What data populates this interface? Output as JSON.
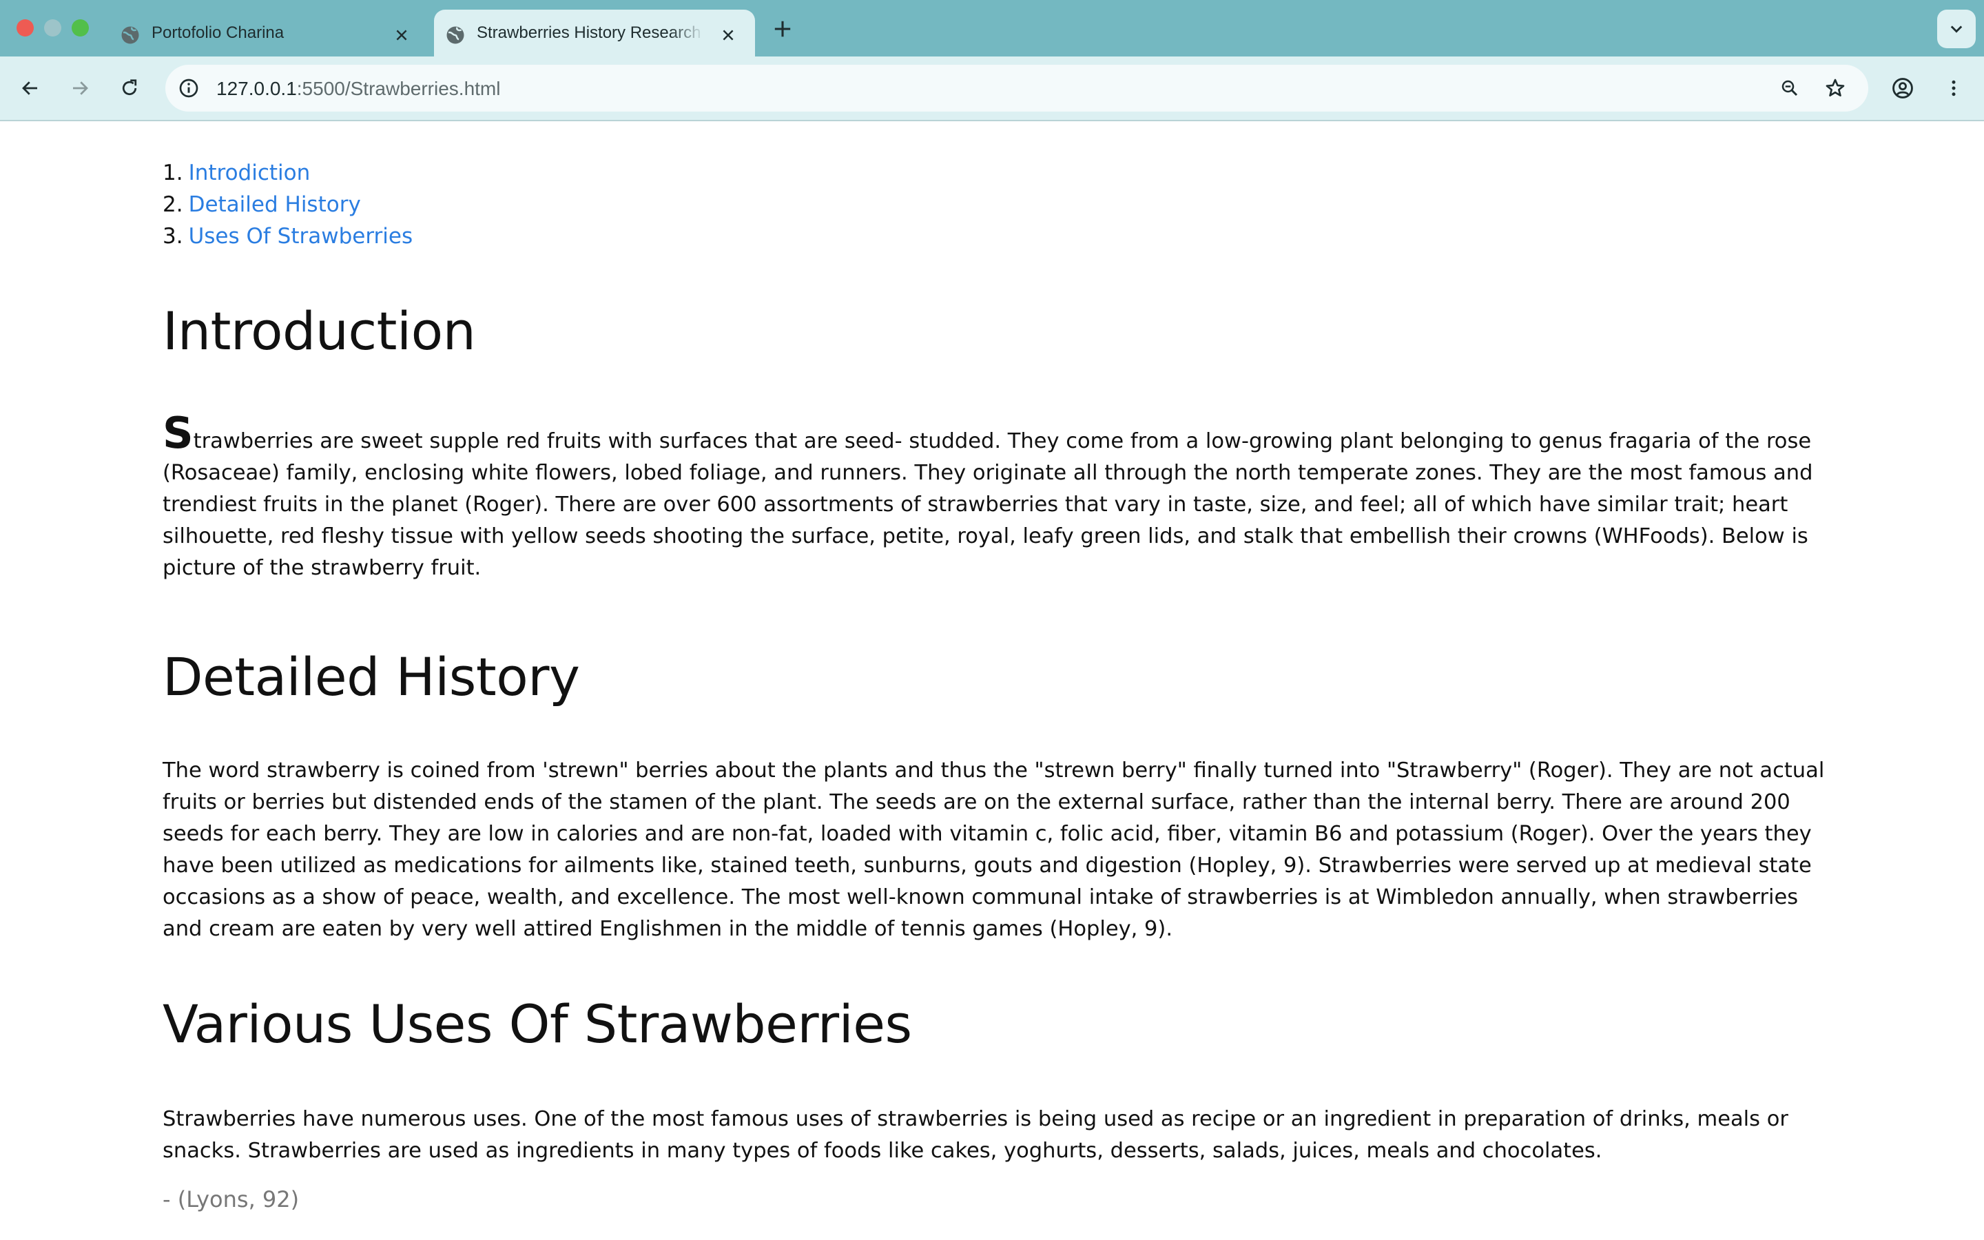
{
  "browser": {
    "tabs": [
      {
        "title": "Portofolio Charina",
        "active": false,
        "icon": "globe-icon"
      },
      {
        "title": "Strawberries History Research",
        "active": true,
        "icon": "globe-icon"
      }
    ],
    "url_host": "127.0.0.1",
    "url_path": ":5500/Strawberries.html",
    "icons": [
      "back-icon",
      "forward-icon",
      "reload-icon",
      "site-info-icon",
      "zoom-icon",
      "bookmark-star-icon",
      "profile-icon",
      "menu-icon"
    ]
  },
  "page": {
    "toc": [
      {
        "num": "1.",
        "label": "Introdiction"
      },
      {
        "num": "2.",
        "label": "Detailed History"
      },
      {
        "num": "3.",
        "label": "Uses Of Strawberries"
      }
    ],
    "intro": {
      "heading": "Introduction",
      "dropcap": "S",
      "text": "trawberries are sweet supple red fruits with surfaces that are seed- studded. They come from a low-growing plant belonging to genus fragaria of the rose (Rosaceae) family, enclosing white flowers, lobed foliage, and runners. They originate all through the north temperate zones. They are the most famous and trendiest fruits in the planet (Roger). There are over 600 assortments of strawberries that vary in taste, size, and feel; all of which have similar trait; heart silhouette, red fleshy tissue with yellow seeds shooting the surface, petite, royal, leafy green lids, and stalk that embellish their crowns (WHFoods). Below is picture of the strawberry fruit."
    },
    "history": {
      "heading": "Detailed History",
      "text": "The word strawberry is coined from 'strewn\" berries about the plants and thus the \"strewn berry\" finally turned into \"Strawberry\" (Roger). They are not actual fruits or berries but distended ends of the stamen of the plant. The seeds are on the external surface, rather than the internal berry. There are around 200 seeds for each berry. They are low in calories and are non-fat, loaded with vitamin c, folic acid, fiber, vitamin B6 and potassium (Roger). Over the years they have been utilized as medications for ailments like, stained teeth, sunburns, gouts and digestion (Hopley, 9). Strawberries were served up at medieval state occasions as a show of peace, wealth, and excellence. The most well-known communal intake of strawberries is at Wimbledon annually, when strawberries and cream are eaten by very well attired Englishmen in the middle of tennis games (Hopley, 9)."
    },
    "uses": {
      "heading": "Various Uses Of Strawberries",
      "text": "Strawberries have numerous uses. One of the most famous uses of strawberries is being used as recipe or an ingredient in preparation of drinks, meals or snacks. Strawberries are used as ingredients in many types of foods like cakes, yoghurts, desserts, salads, juices, meals and chocolates.",
      "citation": "- (Lyons, 92)"
    }
  },
  "colors": {
    "tabstrip": "#74b8c1",
    "toolbar": "#dcf0f2",
    "link": "#2a7de1"
  }
}
